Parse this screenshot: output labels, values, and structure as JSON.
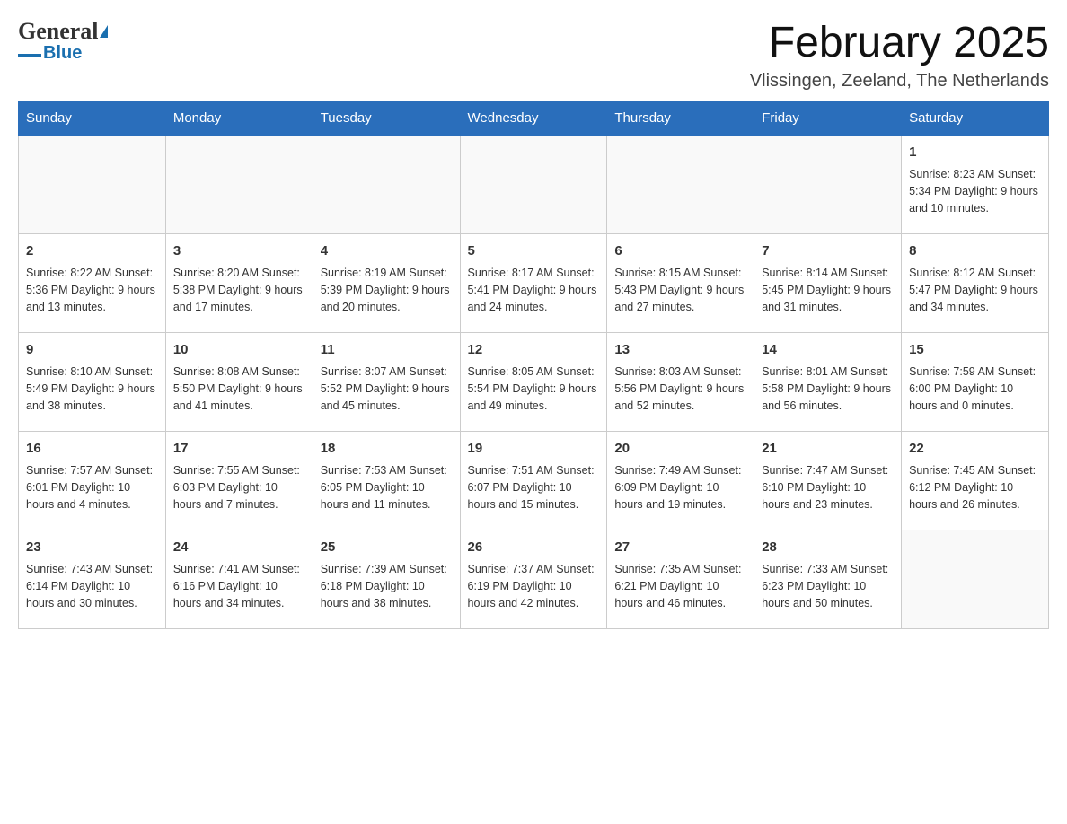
{
  "header": {
    "logo_general": "General",
    "logo_blue": "Blue",
    "title": "February 2025",
    "subtitle": "Vlissingen, Zeeland, The Netherlands"
  },
  "days_of_week": [
    "Sunday",
    "Monday",
    "Tuesday",
    "Wednesday",
    "Thursday",
    "Friday",
    "Saturday"
  ],
  "weeks": [
    {
      "days": [
        {
          "number": "",
          "info": ""
        },
        {
          "number": "",
          "info": ""
        },
        {
          "number": "",
          "info": ""
        },
        {
          "number": "",
          "info": ""
        },
        {
          "number": "",
          "info": ""
        },
        {
          "number": "",
          "info": ""
        },
        {
          "number": "1",
          "info": "Sunrise: 8:23 AM\nSunset: 5:34 PM\nDaylight: 9 hours and 10 minutes."
        }
      ]
    },
    {
      "days": [
        {
          "number": "2",
          "info": "Sunrise: 8:22 AM\nSunset: 5:36 PM\nDaylight: 9 hours and 13 minutes."
        },
        {
          "number": "3",
          "info": "Sunrise: 8:20 AM\nSunset: 5:38 PM\nDaylight: 9 hours and 17 minutes."
        },
        {
          "number": "4",
          "info": "Sunrise: 8:19 AM\nSunset: 5:39 PM\nDaylight: 9 hours and 20 minutes."
        },
        {
          "number": "5",
          "info": "Sunrise: 8:17 AM\nSunset: 5:41 PM\nDaylight: 9 hours and 24 minutes."
        },
        {
          "number": "6",
          "info": "Sunrise: 8:15 AM\nSunset: 5:43 PM\nDaylight: 9 hours and 27 minutes."
        },
        {
          "number": "7",
          "info": "Sunrise: 8:14 AM\nSunset: 5:45 PM\nDaylight: 9 hours and 31 minutes."
        },
        {
          "number": "8",
          "info": "Sunrise: 8:12 AM\nSunset: 5:47 PM\nDaylight: 9 hours and 34 minutes."
        }
      ]
    },
    {
      "days": [
        {
          "number": "9",
          "info": "Sunrise: 8:10 AM\nSunset: 5:49 PM\nDaylight: 9 hours and 38 minutes."
        },
        {
          "number": "10",
          "info": "Sunrise: 8:08 AM\nSunset: 5:50 PM\nDaylight: 9 hours and 41 minutes."
        },
        {
          "number": "11",
          "info": "Sunrise: 8:07 AM\nSunset: 5:52 PM\nDaylight: 9 hours and 45 minutes."
        },
        {
          "number": "12",
          "info": "Sunrise: 8:05 AM\nSunset: 5:54 PM\nDaylight: 9 hours and 49 minutes."
        },
        {
          "number": "13",
          "info": "Sunrise: 8:03 AM\nSunset: 5:56 PM\nDaylight: 9 hours and 52 minutes."
        },
        {
          "number": "14",
          "info": "Sunrise: 8:01 AM\nSunset: 5:58 PM\nDaylight: 9 hours and 56 minutes."
        },
        {
          "number": "15",
          "info": "Sunrise: 7:59 AM\nSunset: 6:00 PM\nDaylight: 10 hours and 0 minutes."
        }
      ]
    },
    {
      "days": [
        {
          "number": "16",
          "info": "Sunrise: 7:57 AM\nSunset: 6:01 PM\nDaylight: 10 hours and 4 minutes."
        },
        {
          "number": "17",
          "info": "Sunrise: 7:55 AM\nSunset: 6:03 PM\nDaylight: 10 hours and 7 minutes."
        },
        {
          "number": "18",
          "info": "Sunrise: 7:53 AM\nSunset: 6:05 PM\nDaylight: 10 hours and 11 minutes."
        },
        {
          "number": "19",
          "info": "Sunrise: 7:51 AM\nSunset: 6:07 PM\nDaylight: 10 hours and 15 minutes."
        },
        {
          "number": "20",
          "info": "Sunrise: 7:49 AM\nSunset: 6:09 PM\nDaylight: 10 hours and 19 minutes."
        },
        {
          "number": "21",
          "info": "Sunrise: 7:47 AM\nSunset: 6:10 PM\nDaylight: 10 hours and 23 minutes."
        },
        {
          "number": "22",
          "info": "Sunrise: 7:45 AM\nSunset: 6:12 PM\nDaylight: 10 hours and 26 minutes."
        }
      ]
    },
    {
      "days": [
        {
          "number": "23",
          "info": "Sunrise: 7:43 AM\nSunset: 6:14 PM\nDaylight: 10 hours and 30 minutes."
        },
        {
          "number": "24",
          "info": "Sunrise: 7:41 AM\nSunset: 6:16 PM\nDaylight: 10 hours and 34 minutes."
        },
        {
          "number": "25",
          "info": "Sunrise: 7:39 AM\nSunset: 6:18 PM\nDaylight: 10 hours and 38 minutes."
        },
        {
          "number": "26",
          "info": "Sunrise: 7:37 AM\nSunset: 6:19 PM\nDaylight: 10 hours and 42 minutes."
        },
        {
          "number": "27",
          "info": "Sunrise: 7:35 AM\nSunset: 6:21 PM\nDaylight: 10 hours and 46 minutes."
        },
        {
          "number": "28",
          "info": "Sunrise: 7:33 AM\nSunset: 6:23 PM\nDaylight: 10 hours and 50 minutes."
        },
        {
          "number": "",
          "info": ""
        }
      ]
    }
  ]
}
